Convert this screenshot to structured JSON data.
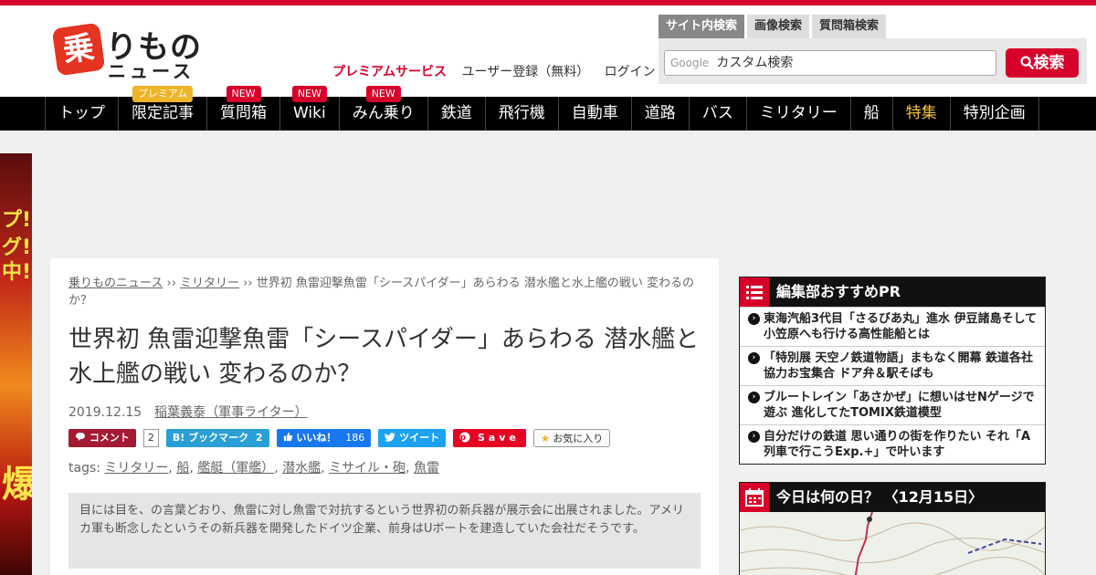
{
  "logo": {
    "badge": "乗",
    "title": "りもの",
    "sub": "ニュース"
  },
  "header": {
    "premium": "プレミアムサービス",
    "register": "ユーザー登録（無料）",
    "login": "ログイン"
  },
  "search": {
    "tabs": [
      "サイト内検索",
      "画像検索",
      "質問箱検索"
    ],
    "google_label": "Google",
    "placeholder": "カスタム検索",
    "button": "検索"
  },
  "nav": [
    {
      "label": "トップ",
      "badge": ""
    },
    {
      "label": "限定記事",
      "badge": "プレミアム"
    },
    {
      "label": "質問箱",
      "badge": "NEW"
    },
    {
      "label": "Wiki",
      "badge": "NEW"
    },
    {
      "label": "みん乗り",
      "badge": "NEW"
    },
    {
      "label": "鉄道",
      "badge": ""
    },
    {
      "label": "飛行機",
      "badge": ""
    },
    {
      "label": "自動車",
      "badge": ""
    },
    {
      "label": "道路",
      "badge": ""
    },
    {
      "label": "バス",
      "badge": ""
    },
    {
      "label": "ミリタリー",
      "badge": ""
    },
    {
      "label": "船",
      "badge": ""
    },
    {
      "label": "特集",
      "badge": ""
    },
    {
      "label": "特別企画",
      "badge": ""
    }
  ],
  "side_ad": {
    "lines": [
      "プ!!",
      "グ!",
      "中!!",
      "爆"
    ]
  },
  "article": {
    "breadcrumb": {
      "home": "乗りものニュース",
      "sep": " ›› ",
      "category": "ミリタリー",
      "current": "世界初 魚雷迎撃魚雷「シースパイダー」あらわる 潜水艦と水上艦の戦い 変わるのか？"
    },
    "title": "世界初 魚雷迎撃魚雷「シースパイダー」あらわる 潜水艦と水上艦の戦い 変わるのか？",
    "date": "2019.12.15",
    "author": "稲葉義泰（軍事ライター）",
    "share": {
      "comment": "コメント",
      "comment_count": "2",
      "hatena": "B! ブックマーク",
      "hatena_count": "2",
      "like": "いいね！",
      "like_count": "186",
      "tweet": "ツイート",
      "save": "Save",
      "fav": "お気に入り"
    },
    "tags_label": "tags:",
    "tags": [
      "ミリタリー",
      "船",
      "艦艇（軍艦）",
      "潜水艦",
      "ミサイル・砲",
      "魚雷"
    ],
    "lead": "目には目を、の言葉どおり、魚雷に対し魚雷で対抗するという世界初の新兵器が展示会に出展されました。アメリカ軍も断念したというその新兵器を開発したドイツ企業、前身はUボートを建造していた会社だそうです。"
  },
  "sidebar": {
    "pr_title": "編集部おすすめPR",
    "pr_items": [
      "東海汽船3代目「さるびあ丸」進水 伊豆諸島そして小笠原へも行ける高性能船とは",
      "「特別展 天空ノ鉄道物語」まもなく開幕 鉄道各社協力お宝集合 ドア弁＆駅そばも",
      "ブルートレイン「あさかぜ」に想いはせNゲージで遊ぶ 進化してたTOMIX鉄道模型",
      "自分だけの鉄道 思い通りの街を作りたい それ「A列車で行こうExp.+」で叶います"
    ],
    "today_title": "今日は何の日？ 〈12月15日〉"
  },
  "colors": {
    "brand": "#d7002a",
    "nav": "#000000",
    "special": "#f5c242"
  }
}
